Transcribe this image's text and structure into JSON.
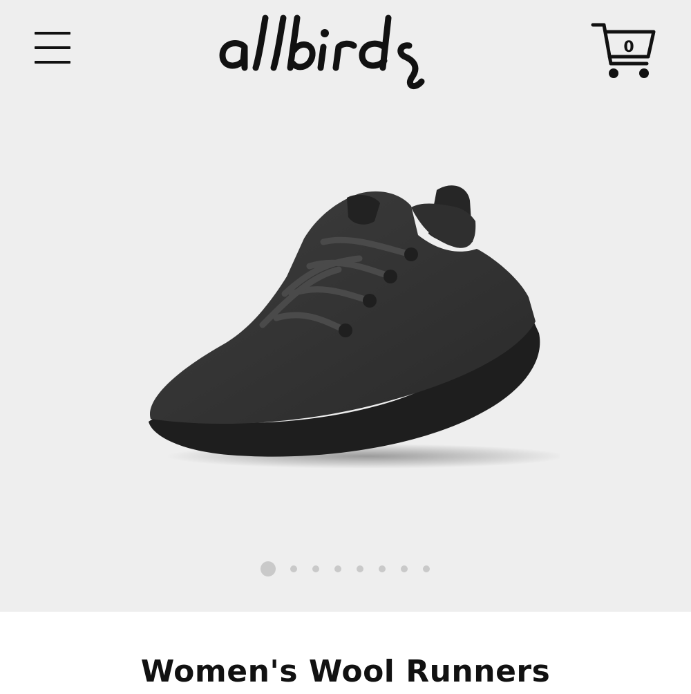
{
  "header": {
    "menu_icon": "hamburger-menu-icon",
    "logo_text": "allbirds",
    "cart_icon": "shopping-cart-icon",
    "cart_count": "0"
  },
  "product": {
    "title": "Women's Wool Runners",
    "image": "charcoal-wool-runner-shoe"
  },
  "carousel": {
    "total_slides": 8,
    "active_slide": 1
  },
  "colors": {
    "hero_background": "#eeeeee",
    "text": "#111111",
    "dot": "#c9c9c9"
  }
}
